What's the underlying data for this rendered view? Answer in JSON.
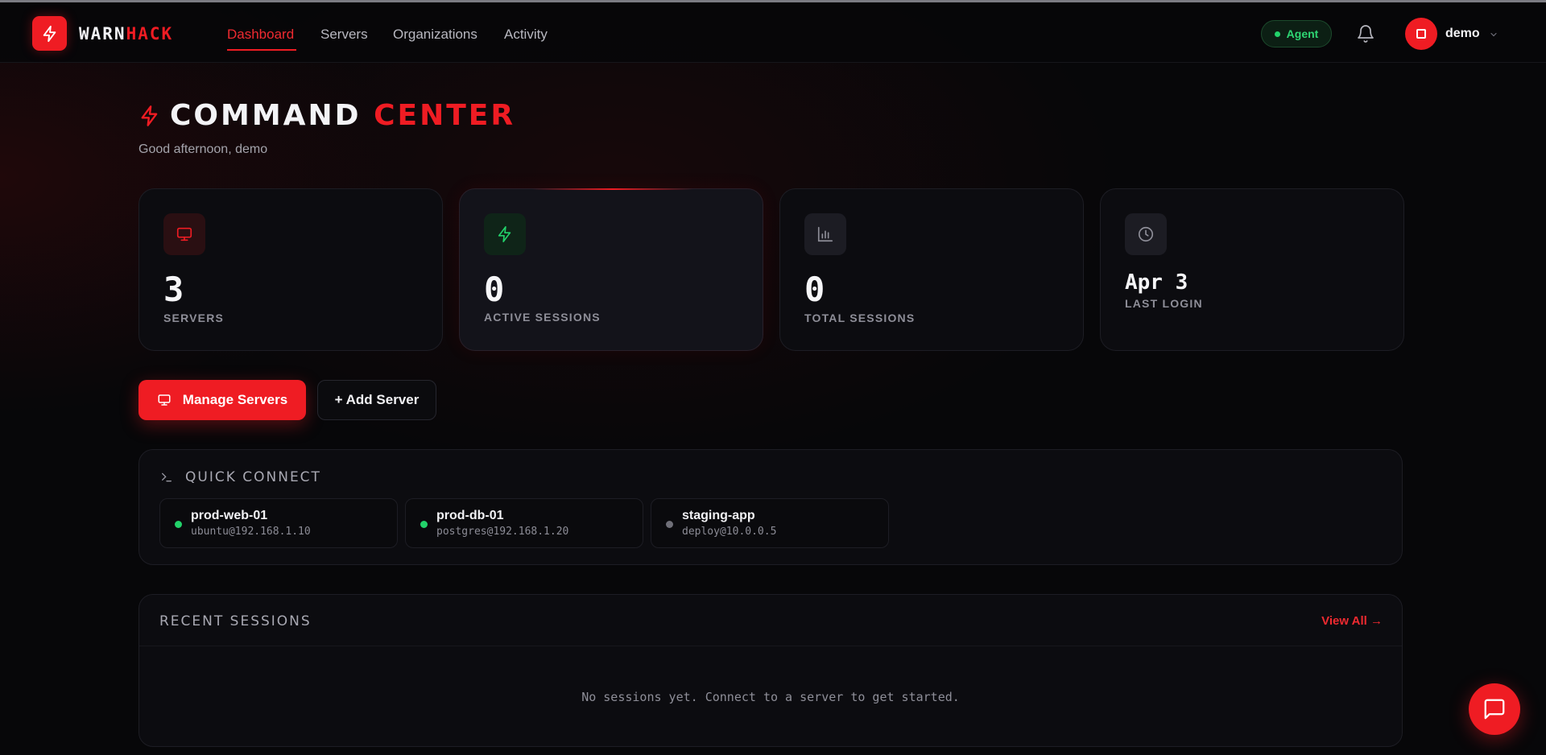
{
  "brand": {
    "part1": "WARN",
    "part2": "HACK"
  },
  "nav": {
    "links": [
      "Dashboard",
      "Servers",
      "Organizations",
      "Activity"
    ],
    "active": "Dashboard"
  },
  "header_right": {
    "agent_label": "Agent",
    "user_name": "demo"
  },
  "page": {
    "title_part1": "COMMAND",
    "title_part2": "CENTER",
    "greeting": "Good afternoon, demo"
  },
  "stats": [
    {
      "value": "3",
      "label": "SERVERS",
      "icon": "monitor-icon"
    },
    {
      "value": "0",
      "label": "ACTIVE SESSIONS",
      "icon": "lightning-icon"
    },
    {
      "value": "0",
      "label": "TOTAL SESSIONS",
      "icon": "bar-chart-icon"
    },
    {
      "value": "Apr 3",
      "label": "LAST LOGIN",
      "icon": "clock-icon"
    }
  ],
  "actions": {
    "primary": "Manage Servers",
    "secondary": "+ Add Server"
  },
  "quick_connect": {
    "title": "QUICK CONNECT",
    "servers": [
      {
        "name": "prod-web-01",
        "address": "ubuntu@192.168.1.10",
        "status": "online"
      },
      {
        "name": "prod-db-01",
        "address": "postgres@192.168.1.20",
        "status": "online"
      },
      {
        "name": "staging-app",
        "address": "deploy@10.0.0.5",
        "status": "offline"
      }
    ]
  },
  "recent_sessions": {
    "title": "RECENT SESSIONS",
    "view_all": "View All →",
    "empty_message": "No sessions yet. Connect to a server to get started."
  },
  "colors": {
    "accent": "#ef1c23",
    "online": "#22d26a",
    "offline": "#6f6f78",
    "background": "#070709"
  }
}
